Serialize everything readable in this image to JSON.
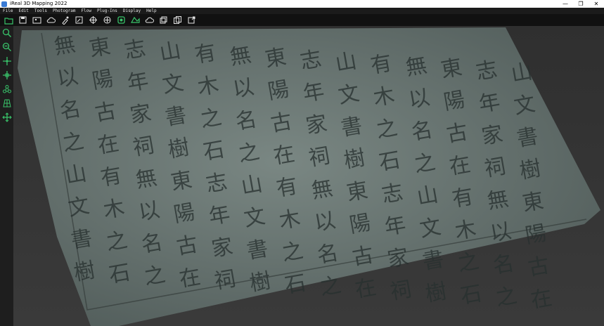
{
  "window": {
    "title": "iReal 3D Mapping 2022",
    "controls": [
      "—",
      "❐",
      "✕"
    ]
  },
  "menu": [
    "File",
    "Edit",
    "Tools",
    "Photogram",
    "Flow",
    "Plug-Ins",
    "Display",
    "Help"
  ],
  "toolbar": [
    {
      "name": "open-folder-icon",
      "color": "#39c36a"
    },
    {
      "name": "save-icon",
      "color": "#e6e6e6"
    },
    {
      "name": "import-photos-icon",
      "color": "#e6e6e6"
    },
    {
      "name": "cloud-icon",
      "color": "#e6e6e6"
    },
    {
      "name": "brush-icon",
      "color": "#e6e6e6"
    },
    {
      "name": "edit-icon",
      "color": "#e6e6e6"
    },
    {
      "name": "target-icon",
      "color": "#e6e6e6"
    },
    {
      "name": "rotate-icon",
      "color": "#e6e6e6"
    },
    {
      "name": "align-icon",
      "color": "#39c36a"
    },
    {
      "name": "mesh-icon",
      "color": "#39c36a"
    },
    {
      "name": "cloud-outline-icon",
      "color": "#e6e6e6"
    },
    {
      "name": "layers-icon",
      "color": "#e6e6e6"
    },
    {
      "name": "copy-icon",
      "color": "#e6e6e6"
    },
    {
      "name": "export-icon",
      "color": "#e6e6e6"
    }
  ],
  "sidebar": [
    {
      "name": "zoom-icon",
      "color": "#39c36a"
    },
    {
      "name": "zoom-extent-icon",
      "color": "#39c36a"
    },
    {
      "name": "crosshair-icon",
      "color": "#39c36a"
    },
    {
      "name": "move-point-icon",
      "color": "#39c36a"
    },
    {
      "name": "nodes-icon",
      "color": "#39c36a"
    },
    {
      "name": "grid-icon",
      "color": "#39c36a"
    },
    {
      "name": "pan-icon",
      "color": "#39c36a"
    }
  ],
  "stone": {
    "surface_color": "#5d6b68",
    "inscription": [
      "無",
      "以",
      "名",
      "之",
      "山",
      "文",
      "書",
      "樹",
      "東",
      "陽",
      "古",
      "在",
      "有",
      "木",
      "之",
      "石",
      "志",
      "年",
      "家",
      "祠"
    ]
  }
}
